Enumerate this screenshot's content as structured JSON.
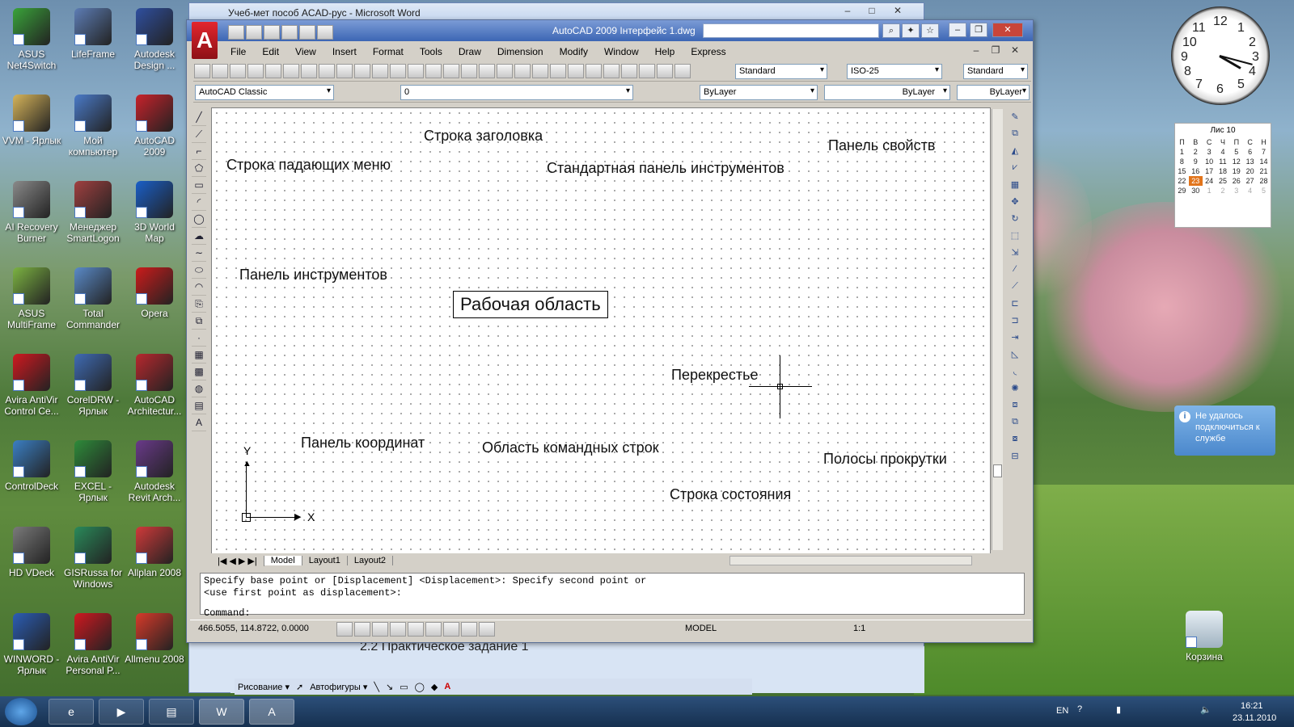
{
  "desktop_icons": [
    {
      "label": "ASUS Net4Switch",
      "color": "#3aa33a"
    },
    {
      "label": "LifeFrame",
      "color": "#5d7db5"
    },
    {
      "label": "Autodesk Design ...",
      "color": "#2f4f9f"
    },
    {
      "label": "VVM - Ярлык",
      "color": "#d6b45a"
    },
    {
      "label": "Мой компьютер",
      "color": "#4a7ac8"
    },
    {
      "label": "AutoCAD 2009",
      "color": "#c8222b"
    },
    {
      "label": "AI Recovery Burner",
      "color": "#8a8a8a"
    },
    {
      "label": "Менеджер SmartLogon",
      "color": "#a04040"
    },
    {
      "label": "3D World Map",
      "color": "#1a5fc8"
    },
    {
      "label": "ASUS MultiFrame",
      "color": "#7cb342"
    },
    {
      "label": "Total Commander",
      "color": "#5a8ac8"
    },
    {
      "label": "Opera",
      "color": "#cc1b1b"
    },
    {
      "label": "Avira AntiVir Control Ce...",
      "color": "#d01820"
    },
    {
      "label": "CorelDRW - Ярлык",
      "color": "#3f6bb4"
    },
    {
      "label": "AutoCAD Architectur...",
      "color": "#b8282e"
    },
    {
      "label": "ControlDeck",
      "color": "#3b7fc4"
    },
    {
      "label": "EXCEL - Ярлык",
      "color": "#2e8b3a"
    },
    {
      "label": "Autodesk Revit Arch...",
      "color": "#6a3a8a"
    },
    {
      "label": "HD VDeck",
      "color": "#7a7a7a"
    },
    {
      "label": "GISRussa for Windows",
      "color": "#2a8a5a"
    },
    {
      "label": "Allplan 2008",
      "color": "#d03a3a"
    },
    {
      "label": "WINWORD - Ярлык",
      "color": "#2b5db5"
    },
    {
      "label": "Avira AntiVir Personal P...",
      "color": "#d01820"
    },
    {
      "label": "Allmenu 2008",
      "color": "#d83a2a"
    }
  ],
  "word_window": {
    "title": "Учеб-мет пособ ACAD-рус - Microsoft Word",
    "partial_text": "2.2 Практическое задание 1"
  },
  "acad": {
    "title": "AutoCAD 2009 Інтерфейс 1.dwg",
    "menu": [
      "File",
      "Edit",
      "View",
      "Insert",
      "Format",
      "Tools",
      "Draw",
      "Dimension",
      "Modify",
      "Window",
      "Help",
      "Express"
    ],
    "combos": {
      "text_style": "Standard",
      "dim_style": "ISO-25",
      "table_style": "Standard",
      "workspace": "AutoCAD Classic",
      "layer": "0",
      "color": "ByLayer",
      "linetype": "ByLayer",
      "lineweight": "ByLayer"
    },
    "labels": {
      "title_bar": "Строка заголовка",
      "props_panel": "Панель свойств",
      "menu_row": "Строка падающих меню",
      "std_toolbar": "Стандартная панель инструментов",
      "toolbars": "Панель инструментов",
      "work_area": "Рабочая область",
      "crosshair": "Перекрестье",
      "coord_panel": "Панель координат",
      "cmd_area": "Область командных строк",
      "scrollbars": "Полосы прокрутки",
      "status_row": "Строка состояния"
    },
    "ucs": {
      "y": "Y",
      "x": "X"
    },
    "tabs": [
      "Model",
      "Layout1",
      "Layout2"
    ],
    "command_lines": [
      "Specify base point or [Displacement] <Displacement>: Specify second point or",
      "<use first point as displacement>:",
      "Command:"
    ],
    "status": {
      "coords": "466.5055, 114.8722, 0.0000",
      "model": "MODEL",
      "scale": "1:1"
    }
  },
  "gadgets": {
    "clock_numbers": [
      "12",
      "1",
      "2",
      "3",
      "4",
      "5",
      "6",
      "7",
      "8",
      "9",
      "10",
      "11"
    ],
    "calendar": {
      "month": "Лис 10",
      "days_header": [
        "П",
        "В",
        "С",
        "Ч",
        "П",
        "С",
        "Н"
      ],
      "weeks": [
        [
          "1",
          "2",
          "3",
          "4",
          "5",
          "6",
          "7"
        ],
        [
          "8",
          "9",
          "10",
          "11",
          "12",
          "13",
          "14"
        ],
        [
          "15",
          "16",
          "17",
          "18",
          "19",
          "20",
          "21"
        ],
        [
          "22",
          "23",
          "24",
          "25",
          "26",
          "27",
          "28"
        ],
        [
          "29",
          "30",
          "1",
          "2",
          "3",
          "4",
          "5"
        ]
      ],
      "today": "23"
    },
    "notification": "Не удалось подключиться к службе"
  },
  "recycle_bin": "Корзина",
  "taskbar": {
    "lang": "EN",
    "time": "16:21",
    "date": "23.11.2010"
  },
  "word_draw_toolbar": {
    "draw": "Рисование ▾",
    "autoshapes": "Автофигуры ▾"
  }
}
